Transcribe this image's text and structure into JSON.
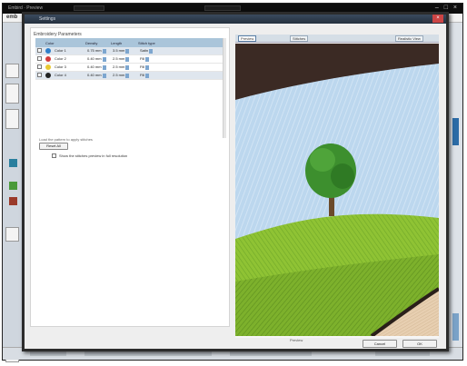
{
  "background_app": {
    "title": "Embird · Preview",
    "window_controls": "– □ ×",
    "logo": "emb"
  },
  "dialog": {
    "title": "Settings",
    "close_glyph": "×",
    "section_title": "Embroidery Parameters",
    "table": {
      "headers": [
        "",
        "Color",
        "Density",
        "Length",
        "Stitch type"
      ],
      "rows": [
        {
          "color_name": "Color 1",
          "color": "#2f7fc9",
          "density": "0.75 mm",
          "length": "3.5 mm",
          "type": "Satin"
        },
        {
          "color_name": "Color 2",
          "color": "#d23b3b",
          "density": "0.40 mm",
          "length": "2.5 mm",
          "type": "Fill"
        },
        {
          "color_name": "Color 3",
          "color": "#e8c832",
          "density": "0.40 mm",
          "length": "2.5 mm",
          "type": "Fill"
        },
        {
          "color_name": "Color 4",
          "color": "#222222",
          "density": "0.40 mm",
          "length": "2.5 mm",
          "type": "Fill"
        }
      ]
    },
    "hint": "Load the pattern to apply stitches",
    "reset_button": "Reset All",
    "checkbox_label": "Show the stitches preview in full resolution",
    "tabs": [
      "Preview",
      "Stitches",
      "Realistic View"
    ],
    "caption": "Preview",
    "ok_button": "OK",
    "cancel_button": "Cancel"
  },
  "icons": {
    "color_swatch": "color-dot-icon",
    "spinner": "spinner-icon",
    "close": "close-icon"
  },
  "colors": {
    "sky": "#bcd7ee",
    "grass": "#8fc334",
    "dark_grass": "#5d8f1e",
    "tree": "#3d8f2e",
    "dark_band": "#3b2a24",
    "beige_band": "#e7cfb1",
    "table_header": "#aac5da"
  }
}
